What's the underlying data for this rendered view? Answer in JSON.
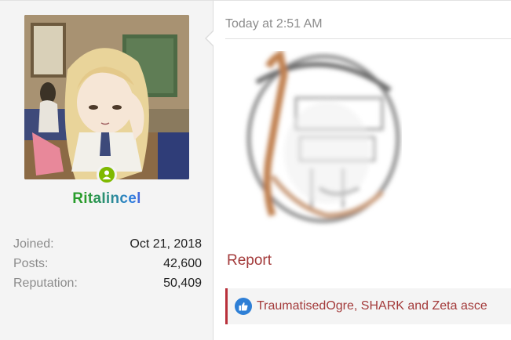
{
  "post": {
    "user": {
      "name": "RitaIincel",
      "online_status": "online",
      "stats": [
        {
          "label": "Joined:",
          "value": "Oct 21, 2018"
        },
        {
          "label": "Posts:",
          "value": "42,600"
        },
        {
          "label": "Reputation:",
          "value": "50,409"
        }
      ]
    },
    "timestamp": "Today at 2:51 AM",
    "actions": {
      "report_label": "Report"
    },
    "likes": {
      "text": "TraumatisedOgre, SHARK and Zeta asce"
    }
  },
  "colors": {
    "link": "#a33a3a",
    "online": "#7fb900",
    "like_icon": "#2e7fd6",
    "likes_bar_accent": "#b8303a"
  },
  "icons": [
    "avatar-image",
    "online-status-icon",
    "thumbs-up-icon"
  ]
}
